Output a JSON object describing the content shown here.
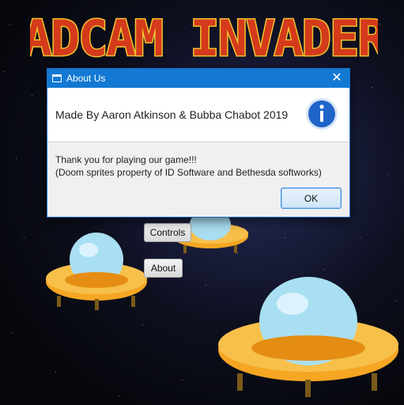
{
  "game": {
    "logo_text": "CADCAM INVADERS",
    "buttons": {
      "controls_label": "Controls",
      "about_label": "About"
    }
  },
  "dialog": {
    "title": "About Us",
    "close_icon": "close-icon",
    "header_text": "Made By Aaron Atkinson & Bubba Chabot 2019",
    "header_icon": "info-icon",
    "content_line1": "Thank you for playing our game!!!",
    "content_line2": "(Doom sprites property of ID Software and Bethesda softworks)",
    "ok_label": "OK"
  },
  "colors": {
    "titlebar": "#1379d3",
    "info_icon": "#1f64c8",
    "logo_fill": "#d43a1b",
    "logo_outline": "#f2c230",
    "ufo_body": "#f5a623",
    "ufo_dome": "#a9dff2"
  }
}
